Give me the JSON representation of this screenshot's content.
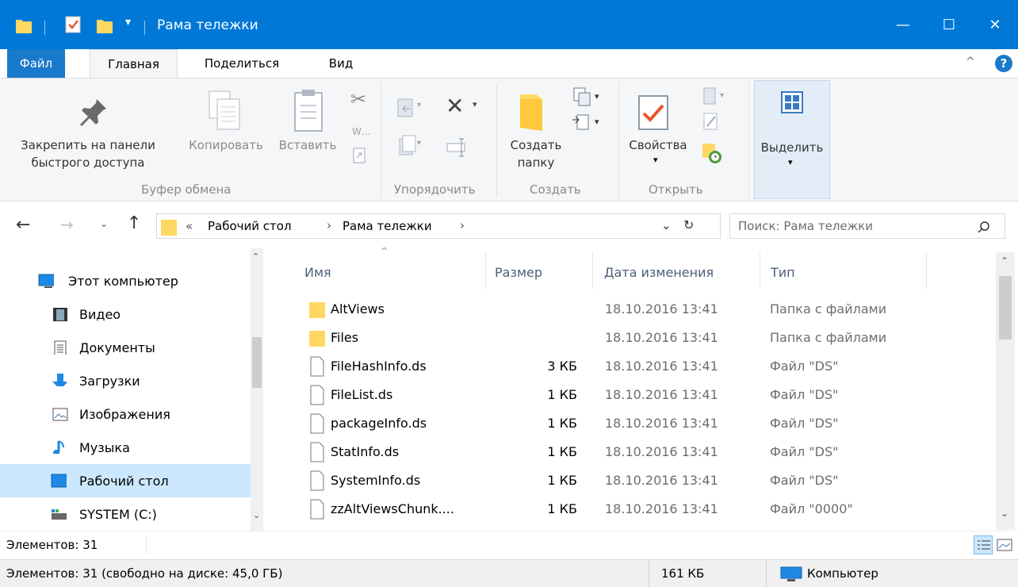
{
  "window": {
    "title": "Рама тележки",
    "minimize": "—",
    "maximize": "☐",
    "close": "✕"
  },
  "menu": {
    "file": "Файл",
    "tabs": [
      "Главная",
      "Поделиться",
      "Вид"
    ],
    "help_icon": "?"
  },
  "ribbon": {
    "pin_line1": "Закрепить на панели",
    "pin_line2": "быстрого доступа",
    "copy": "Копировать",
    "paste": "Вставить",
    "group_clipboard": "Буфер обмена",
    "group_organize": "Упорядочить",
    "new_folder_line1": "Создать",
    "new_folder_line2": "папку",
    "group_new": "Создать",
    "properties": "Свойства",
    "group_open": "Открыть",
    "select": "Выделить"
  },
  "address": {
    "chevrons": "«",
    "crumbs": [
      "Рабочий стол",
      "Рама тележки"
    ],
    "search_placeholder": "Поиск: Рама тележки"
  },
  "nav": {
    "items": [
      {
        "label": "Этот компьютер",
        "icon": "computer-icon"
      },
      {
        "label": "Видео",
        "icon": "video-icon"
      },
      {
        "label": "Документы",
        "icon": "documents-icon"
      },
      {
        "label": "Загрузки",
        "icon": "downloads-icon"
      },
      {
        "label": "Изображения",
        "icon": "pictures-icon"
      },
      {
        "label": "Музыка",
        "icon": "music-icon"
      },
      {
        "label": "Рабочий стол",
        "icon": "desktop-icon"
      },
      {
        "label": "SYSTEM (C:)",
        "icon": "drive-icon"
      }
    ],
    "selected": "Рабочий стол"
  },
  "columns": {
    "name": "Имя",
    "size": "Размер",
    "date": "Дата изменения",
    "type": "Тип"
  },
  "files": [
    {
      "name": "AltViews",
      "size": "",
      "date": "18.10.2016 13:41",
      "type": "Папка с файлами",
      "kind": "folder"
    },
    {
      "name": "Files",
      "size": "",
      "date": "18.10.2016 13:41",
      "type": "Папка с файлами",
      "kind": "folder"
    },
    {
      "name": "FileHashInfo.ds",
      "size": "3 КБ",
      "date": "18.10.2016 13:41",
      "type": "Файл \"DS\"",
      "kind": "file"
    },
    {
      "name": "FileList.ds",
      "size": "1 КБ",
      "date": "18.10.2016 13:41",
      "type": "Файл \"DS\"",
      "kind": "file"
    },
    {
      "name": "packageInfo.ds",
      "size": "1 КБ",
      "date": "18.10.2016 13:41",
      "type": "Файл \"DS\"",
      "kind": "file"
    },
    {
      "name": "StatInfo.ds",
      "size": "1 КБ",
      "date": "18.10.2016 13:41",
      "type": "Файл \"DS\"",
      "kind": "file"
    },
    {
      "name": "SystemInfo.ds",
      "size": "1 КБ",
      "date": "18.10.2016 13:41",
      "type": "Файл \"DS\"",
      "kind": "file"
    },
    {
      "name": "zzAltViewsChunk....",
      "size": "1 КБ",
      "date": "18.10.2016 13:41",
      "type": "Файл \"0000\"",
      "kind": "file"
    }
  ],
  "status": {
    "items_count": "Элементов: 31",
    "bottom_left": "Элементов: 31 (свободно на диске: 45,0 ГБ)",
    "bottom_size": "161 КБ",
    "bottom_location": "Компьютер"
  },
  "colors": {
    "accent": "#0078d7",
    "selected": "#cce8ff",
    "folder": "#ffd863"
  }
}
